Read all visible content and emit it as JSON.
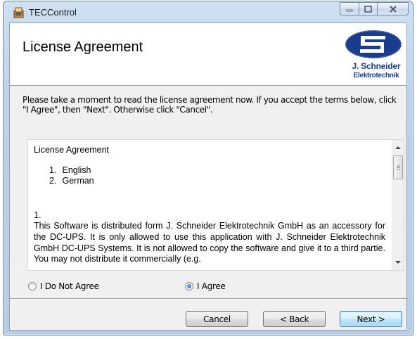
{
  "window": {
    "title": "TECControl"
  },
  "banner": {
    "title": "License Agreement",
    "logo_line1": "J. Schneider",
    "logo_line2": "Elektrotechnik"
  },
  "instructions": "Please take a moment to read the license agreement now. If you accept the terms below, click \"I Agree\", then \"Next\". Otherwise click \"Cancel\".",
  "license": {
    "heading": "License Agreement",
    "list": [
      {
        "num": "1.",
        "label": "English"
      },
      {
        "num": "2.",
        "label": "German"
      }
    ],
    "section_number": "1.",
    "body": "This Software is distributed form J. Schneider Elektrotechnik GmbH as an accessory for the DC-UPS. It is only allowed to use this application with J. Schneider Elektrotechnik GmbH DC-UPS Systems. It is not allowed to copy the software and give it to a third partie. You may not distribute it commercially (e.g."
  },
  "options": {
    "disagree_label": "I Do Not Agree",
    "agree_label": "I Agree",
    "selected": "agree"
  },
  "buttons": {
    "cancel": "Cancel",
    "back": "< Back",
    "next": "Next >"
  },
  "colors": {
    "brand": "#1a3c8c",
    "default_button_border": "#3c7fb1"
  }
}
